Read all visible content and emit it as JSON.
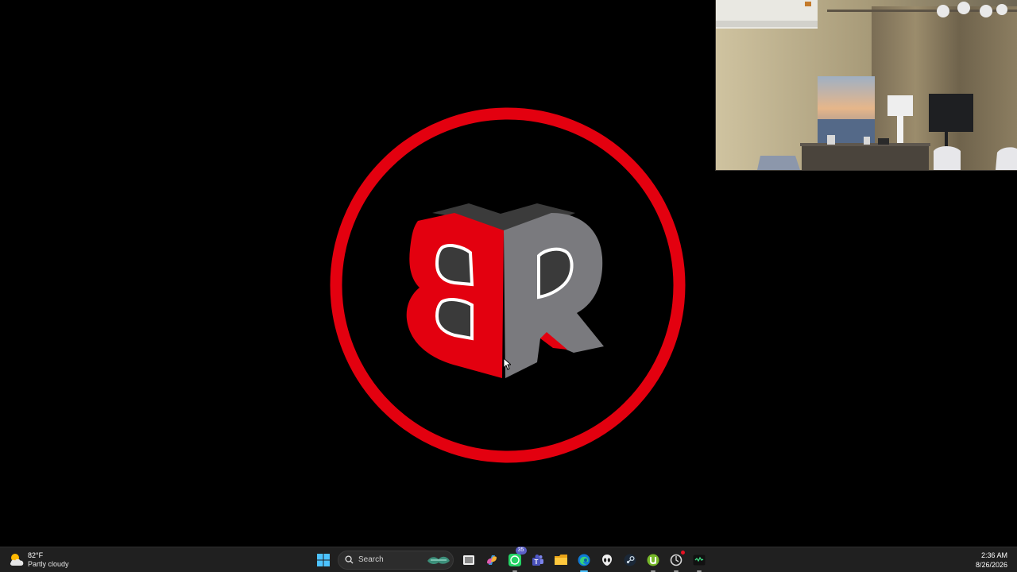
{
  "taskbar": {
    "weather": {
      "temperature": "82°F",
      "condition": "Partly cloudy"
    },
    "search": {
      "label": "Search"
    },
    "apps": [
      {
        "name": "start",
        "icon": "windows-start-icon"
      },
      {
        "name": "task-view",
        "icon": "task-view-icon"
      },
      {
        "name": "copilot",
        "icon": "copilot-icon"
      },
      {
        "name": "whatsapp",
        "icon": "whatsapp-icon",
        "badge": "35"
      },
      {
        "name": "teams",
        "icon": "teams-icon"
      },
      {
        "name": "file-explorer",
        "icon": "folder-icon"
      },
      {
        "name": "edge",
        "icon": "edge-browser-icon"
      },
      {
        "name": "alienware",
        "icon": "alienware-icon"
      },
      {
        "name": "steam",
        "icon": "steam-icon"
      },
      {
        "name": "utorrent",
        "icon": "utorrent-icon"
      },
      {
        "name": "app-with-alert",
        "icon": "circle-app-icon"
      },
      {
        "name": "terminal",
        "icon": "terminal-app-icon"
      }
    ],
    "clock": {
      "time": "2:36 AM",
      "date": "8/26/2026"
    }
  },
  "colors": {
    "logo_red": "#E3000F",
    "logo_gray": "#7A7A7E",
    "taskbar_bg": "#202020",
    "accent_blue": "#4CC2FF"
  }
}
